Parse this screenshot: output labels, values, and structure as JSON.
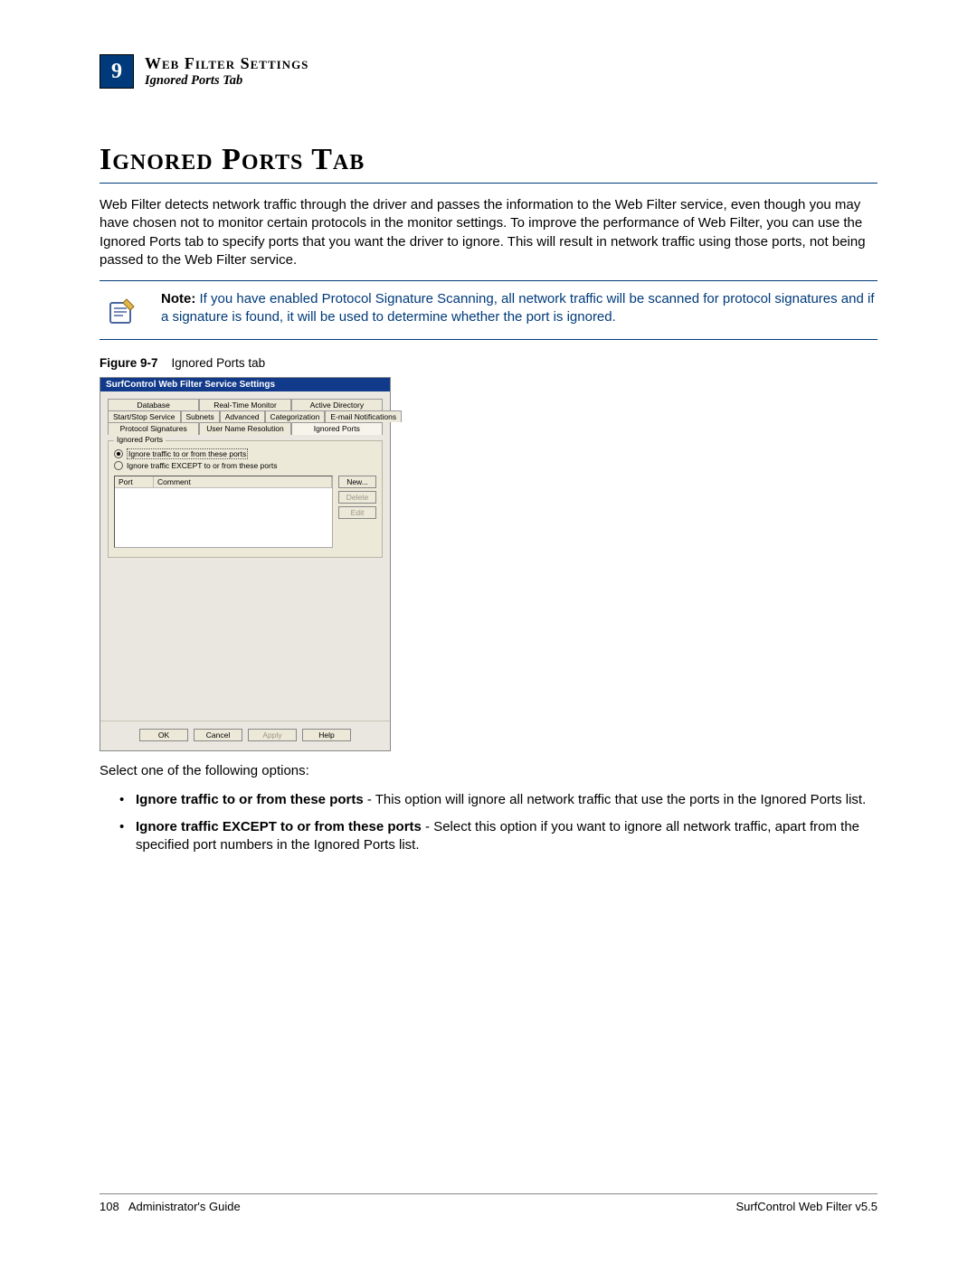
{
  "header": {
    "chapter_number": "9",
    "title": "Web Filter Settings",
    "subtitle": "Ignored Ports Tab"
  },
  "section": {
    "title": "Ignored Ports Tab",
    "intro": "Web Filter detects network traffic through the driver and passes the information to the Web Filter service, even though you may have chosen not to monitor certain protocols in the monitor settings. To improve the performance of Web Filter, you can use the Ignored Ports tab to specify ports that you want the driver to ignore. This will result in network traffic using those ports, not being passed to the Web Filter service."
  },
  "note": {
    "label": "Note:",
    "text": "If you have enabled Protocol Signature Scanning, all network traffic will be scanned for protocol signatures and if a signature is found, it will be used to determine whether the port is ignored."
  },
  "figure": {
    "label": "Figure 9-7",
    "caption": "Ignored Ports tab"
  },
  "dialog": {
    "title": "SurfControl Web Filter Service Settings",
    "tabs_row1": [
      "Database",
      "Real-Time Monitor",
      "Active Directory"
    ],
    "tabs_row2": [
      "Start/Stop Service",
      "Subnets",
      "Advanced",
      "Categorization",
      "E-mail Notifications"
    ],
    "tabs_row3": [
      "Protocol Signatures",
      "User Name Resolution",
      "Ignored Ports"
    ],
    "active_tab": "Ignored Ports",
    "group_legend": "Ignored Ports",
    "radio1": "Ignore traffic to or from these ports",
    "radio2": "Ignore traffic EXCEPT to or from these ports",
    "col_port": "Port",
    "col_comment": "Comment",
    "btn_new": "New...",
    "btn_delete": "Delete",
    "btn_edit": "Edit",
    "btn_ok": "OK",
    "btn_cancel": "Cancel",
    "btn_apply": "Apply",
    "btn_help": "Help"
  },
  "options_intro": "Select one of the following options:",
  "bullets": {
    "b1_bold": "Ignore traffic to or from these ports",
    "b1_rest": " - This option will ignore all network traffic that use the ports in the Ignored Ports list.",
    "b2_bold": "Ignore traffic EXCEPT to or from these ports",
    "b2_rest": " - Select this option if you want to ignore all network traffic, apart from the specified port numbers in the Ignored Ports list."
  },
  "footer": {
    "left_page": "108",
    "left_text": "Administrator's Guide",
    "right": "SurfControl Web Filter v5.5"
  }
}
